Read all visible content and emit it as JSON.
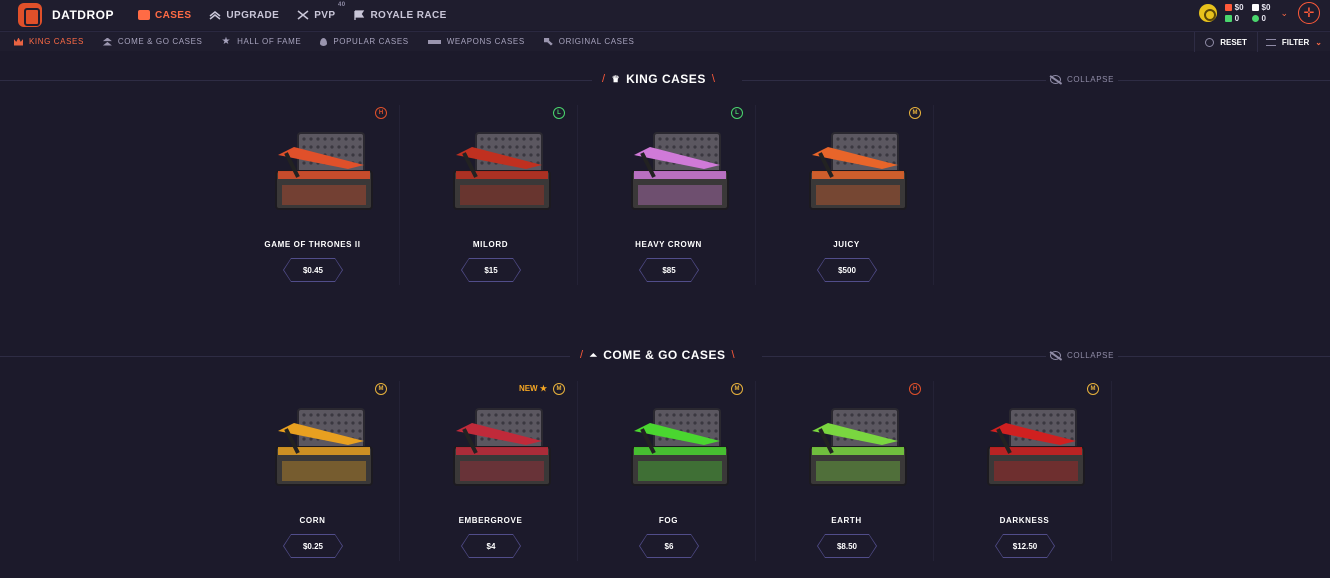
{
  "brand": {
    "name": "DATDROP"
  },
  "nav": [
    {
      "label": "CASES",
      "icon": "cases-icon",
      "active": true
    },
    {
      "label": "UPGRADE",
      "icon": "upgrade-icon",
      "active": false
    },
    {
      "label": "PVP",
      "icon": "pvp-swords-icon",
      "active": false,
      "badge": "40"
    },
    {
      "label": "ROYALE RACE",
      "icon": "flag-icon",
      "active": false
    }
  ],
  "balances": [
    {
      "value": "$0",
      "icon": "cash-icon",
      "color": "#ff5a3a"
    },
    {
      "value": "$0",
      "icon": "gun-icon",
      "color": "#ffffff"
    },
    {
      "value": "0",
      "icon": "gem-green-icon",
      "color": "#4ad66d"
    },
    {
      "value": "0",
      "icon": "d-token-icon",
      "color": "#4ad66d"
    }
  ],
  "subnav": [
    {
      "label": "KING CASES",
      "icon": "crown-icon",
      "active": true
    },
    {
      "label": "COME & GO CASES",
      "icon": "double-arrow-icon",
      "active": false
    },
    {
      "label": "HALL OF FAME",
      "icon": "star-icon",
      "active": false
    },
    {
      "label": "POPULAR CASES",
      "icon": "flame-icon",
      "active": false
    },
    {
      "label": "WEAPONS CASES",
      "icon": "rifle-icon",
      "active": false
    },
    {
      "label": "ORIGINAL CASES",
      "icon": "wrench-icon",
      "active": false
    }
  ],
  "toolbar": {
    "reset_label": "RESET",
    "filter_label": "FILTER"
  },
  "sections": [
    {
      "title": "KING CASES",
      "icon": "crown-icon",
      "collapse_label": "COLLAPSE",
      "cases": [
        {
          "name": "GAME OF THRONES II",
          "price": "$0.45",
          "tier": "H",
          "tier_color": "#e0502a",
          "accent": "#e0502a"
        },
        {
          "name": "MILORD",
          "price": "$15",
          "tier": "L",
          "tier_color": "#4ad66d",
          "accent": "#c03020"
        },
        {
          "name": "HEAVY CROWN",
          "price": "$85",
          "tier": "L",
          "tier_color": "#4ad66d",
          "accent": "#d07ad8"
        },
        {
          "name": "JUICY",
          "price": "$500",
          "tier": "M",
          "tier_color": "#e8b23c",
          "accent": "#e8652a"
        }
      ]
    },
    {
      "title": "COME & GO CASES",
      "icon": "double-arrow-icon",
      "collapse_label": "COLLAPSE",
      "cases": [
        {
          "name": "CORN",
          "price": "$0.25",
          "tier": "M",
          "tier_color": "#e8b23c",
          "accent": "#e8a020",
          "new": false
        },
        {
          "name": "EMBERGROVE",
          "price": "$4",
          "tier": "M",
          "tier_color": "#e8b23c",
          "accent": "#c02a3a",
          "new": true,
          "new_label": "NEW ★"
        },
        {
          "name": "FOG",
          "price": "$6",
          "tier": "M",
          "tier_color": "#e8b23c",
          "accent": "#4ad630",
          "new": false
        },
        {
          "name": "EARTH",
          "price": "$8.50",
          "tier": "H",
          "tier_color": "#e0502a",
          "accent": "#7ad640",
          "new": false
        },
        {
          "name": "DARKNESS",
          "price": "$12.50",
          "tier": "M",
          "tier_color": "#e8b23c",
          "accent": "#d02020",
          "new": false
        }
      ]
    }
  ]
}
